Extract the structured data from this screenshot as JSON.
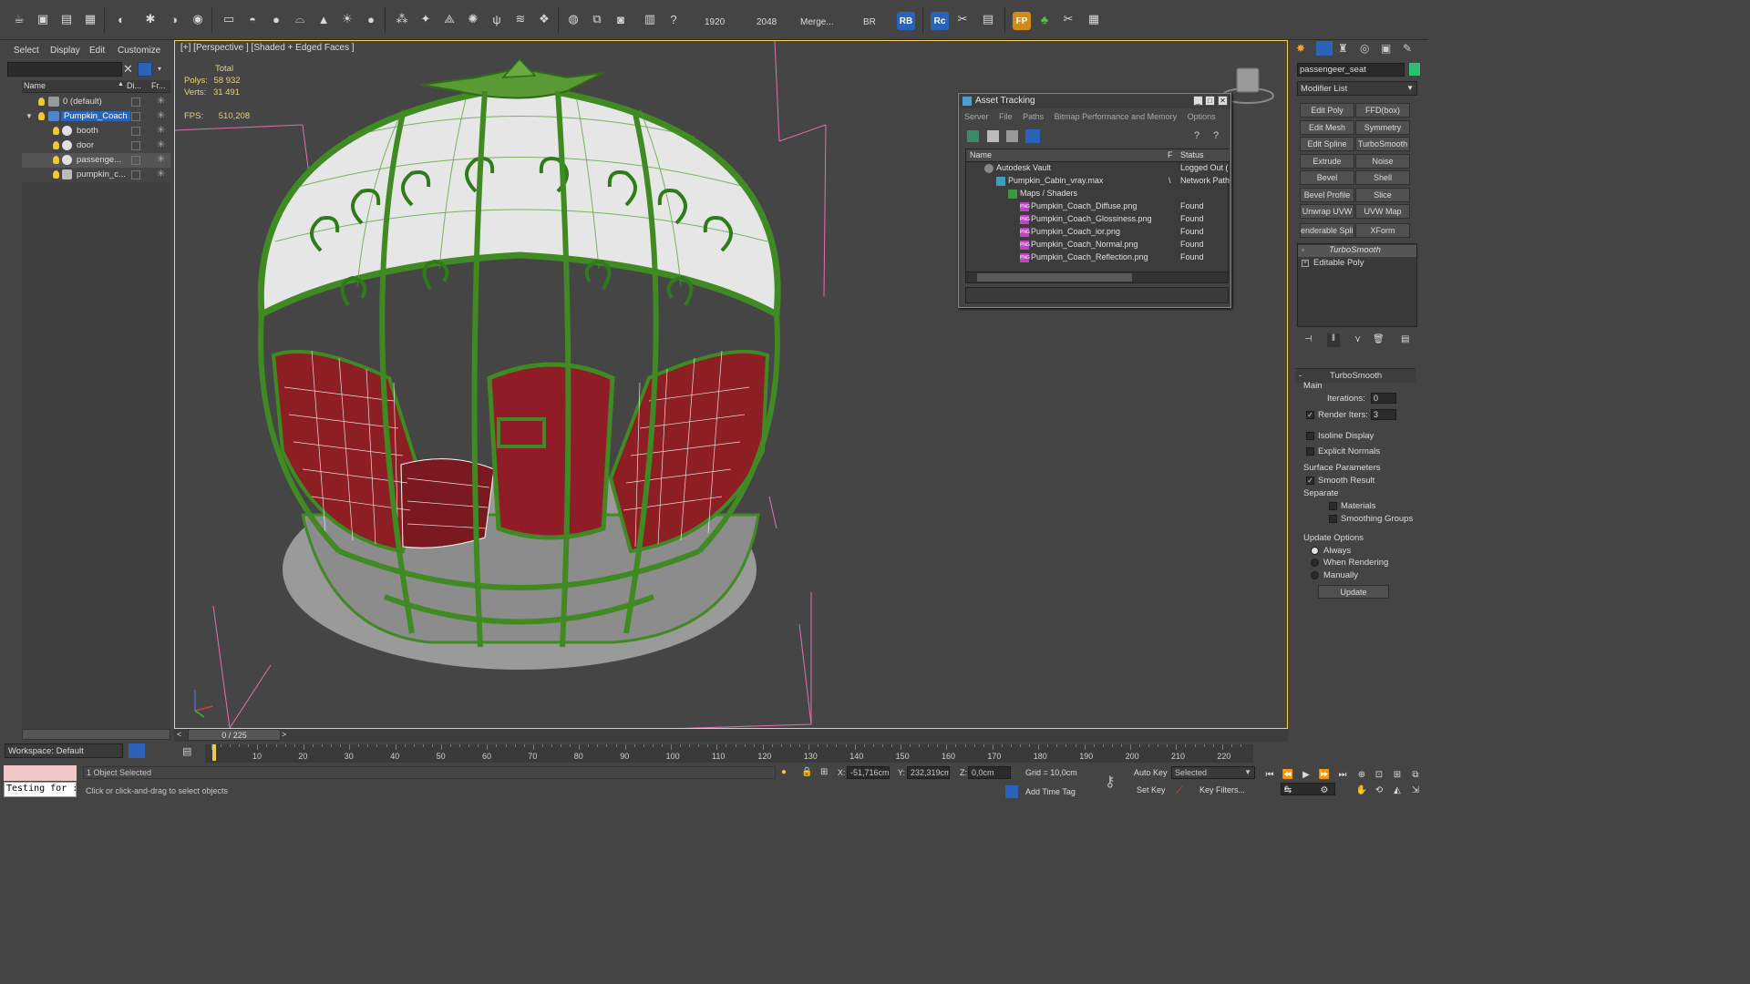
{
  "toolbar": {
    "render_width": "1920",
    "render_height": "2048",
    "merge_label": "Merge...",
    "br_label": "BR",
    "rb_badge": "RB",
    "rc_badge": "Rc",
    "fp_badge": "FP"
  },
  "scene_explorer": {
    "menu": [
      "Select",
      "Display",
      "Edit",
      "Customize"
    ],
    "columns": [
      "Name",
      "Di...",
      "Fr..."
    ],
    "rows": [
      "0 (default)",
      "Pumpkin_Coach",
      "booth",
      "door",
      "passenge...",
      "pumpkin_c..."
    ],
    "workspace": "Workspace: Default"
  },
  "viewport": {
    "label": "[+] [Perspective ] [Shaded + Edged Faces ]",
    "stats_total": "Total",
    "polys_label": "Polys:",
    "polys_value": "58 932",
    "verts_label": "Verts:",
    "verts_value": "31 491",
    "fps_label": "FPS:",
    "fps_value": "510,208"
  },
  "asset_tracking": {
    "title": "Asset Tracking",
    "menu": [
      "Server",
      "File",
      "Paths",
      "Bitmap Performance and Memory",
      "Options"
    ],
    "col_name": "Name",
    "col_f": "F",
    "col_status": "Status",
    "rows": [
      {
        "name": "Autodesk Vault",
        "status": "Logged Out ("
      },
      {
        "name": "Pumpkin_Cabin_vray.max",
        "status": "Network Path"
      },
      {
        "name": "Maps / Shaders",
        "status": ""
      },
      {
        "name": "Pumpkin_Coach_Diffuse.png",
        "status": "Found"
      },
      {
        "name": "Pumpkin_Coach_Glossiness.png",
        "status": "Found"
      },
      {
        "name": "Pumpkin_Coach_ior.png",
        "status": "Found"
      },
      {
        "name": "Pumpkin_Coach_Normal.png",
        "status": "Found"
      },
      {
        "name": "Pumpkin_Coach_Reflection.png",
        "status": "Found"
      }
    ]
  },
  "command_panel": {
    "object_name": "passengeer_seat",
    "modifier_list": "Modifier List",
    "modifier_buttons": [
      "Edit Poly",
      "FFD(box)",
      "Edit Mesh",
      "Symmetry",
      "Edit Spline",
      "TurboSmooth",
      "Extrude",
      "Noise",
      "Bevel",
      "Shell",
      "Bevel Profile",
      "Slice",
      "Unwrap UVW",
      "UVW Map",
      "enderable Splin",
      "XForm"
    ],
    "stack": [
      "TurboSmooth",
      "Editable Poly"
    ],
    "rollout_title": "TurboSmooth",
    "main_label": "Main",
    "iterations_label": "Iterations:",
    "iterations_value": "0",
    "render_iters_label": "Render Iters:",
    "render_iters_value": "3",
    "isoline_label": "Isoline Display",
    "explicit_label": "Explicit Normals",
    "surface_label": "Surface Parameters",
    "smooth_label": "Smooth Result",
    "separate_label": "Separate",
    "materials_label": "Materials",
    "smoothing_label": "Smoothing Groups",
    "update_options_label": "Update Options",
    "always_label": "Always",
    "when_rendering_label": "When Rendering",
    "manually_label": "Manually",
    "update_button": "Update"
  },
  "timeline": {
    "frame_counter": "0 / 225",
    "ticks": [
      "10",
      "20",
      "30",
      "40",
      "50",
      "60",
      "70",
      "80",
      "90",
      "100",
      "110",
      "120",
      "130",
      "140",
      "150",
      "160",
      "170",
      "180",
      "190",
      "200",
      "210",
      "220"
    ]
  },
  "status_bar": {
    "script_text": "Testing for :",
    "selected_text": "1 Object Selected",
    "prompt_text": "Click or click-and-drag to select objects",
    "x_label": "X:",
    "x_value": "-51,716cm",
    "y_label": "Y:",
    "y_value": "232,319cm",
    "z_label": "Z:",
    "z_value": "0,0cm",
    "grid": "Grid = 10,0cm",
    "add_time_tag": "Add Time Tag",
    "auto_key": "Auto Key",
    "set_key": "Set Key",
    "selected_dropdown": "Selected",
    "key_filters": "Key Filters...",
    "frame_value": "0"
  },
  "colors": {
    "accent_blue": "#2a63b8",
    "frame_green": "#3f8a22",
    "seat_red": "#8c1e24",
    "viewport_border": "#ffd04a"
  }
}
